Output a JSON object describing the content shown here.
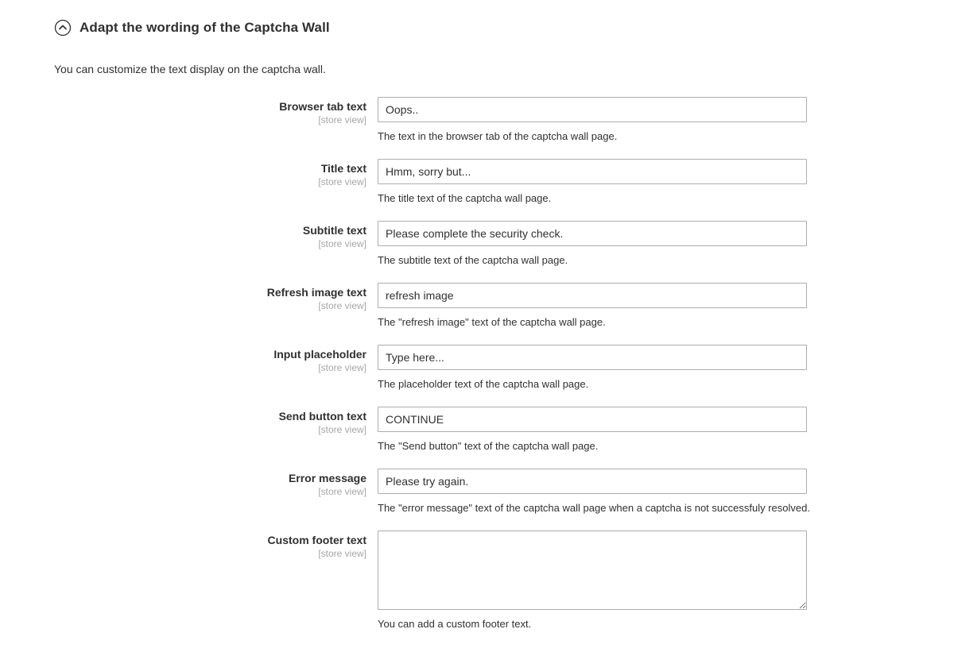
{
  "section": {
    "title": "Adapt the wording of the Captcha Wall",
    "intro": "You can customize the text display on the captcha wall.",
    "collapse_icon": "chevron-up-circle-icon",
    "expanded": true
  },
  "scope_label": "[store view]",
  "colors": {
    "text": "#303030",
    "scope_text": "#a6a6a6",
    "input_border": "#adadad",
    "input_background": "#ffffff",
    "page_background": "#ffffff",
    "focus_border": "#007bdb"
  },
  "fields": [
    {
      "id": "browser-tab-text",
      "label": "Browser tab text",
      "scope": "[store view]",
      "type": "text",
      "value": "Oops..",
      "placeholder": "",
      "note": "The text in the browser tab of the captcha wall page."
    },
    {
      "id": "title-text",
      "label": "Title text",
      "scope": "[store view]",
      "type": "text",
      "value": "Hmm, sorry but...",
      "placeholder": "",
      "note": "The title text of the captcha wall page."
    },
    {
      "id": "subtitle-text",
      "label": "Subtitle text",
      "scope": "[store view]",
      "type": "text",
      "value": "Please complete the security check.",
      "placeholder": "",
      "note": "The subtitle text of the captcha wall page."
    },
    {
      "id": "refresh-image-text",
      "label": "Refresh image text",
      "scope": "[store view]",
      "type": "text",
      "value": "refresh image",
      "placeholder": "",
      "note": "The \"refresh image\" text of the captcha wall page."
    },
    {
      "id": "input-placeholder",
      "label": "Input placeholder",
      "scope": "[store view]",
      "type": "text",
      "value": "Type here...",
      "placeholder": "",
      "note": "The placeholder text of the captcha wall page."
    },
    {
      "id": "send-button-text",
      "label": "Send button text",
      "scope": "[store view]",
      "type": "text",
      "value": "CONTINUE",
      "placeholder": "",
      "note": "The \"Send button\" text of the captcha wall page."
    },
    {
      "id": "error-message",
      "label": "Error message",
      "scope": "[store view]",
      "type": "text",
      "value": "Please try again.",
      "placeholder": "",
      "note": "The \"error message\" text of the captcha wall page when a captcha is not successfuly resolved."
    },
    {
      "id": "custom-footer-text",
      "label": "Custom footer text",
      "scope": "[store view]",
      "type": "textarea",
      "value": "",
      "placeholder": "",
      "note": "You can add a custom footer text."
    }
  ]
}
